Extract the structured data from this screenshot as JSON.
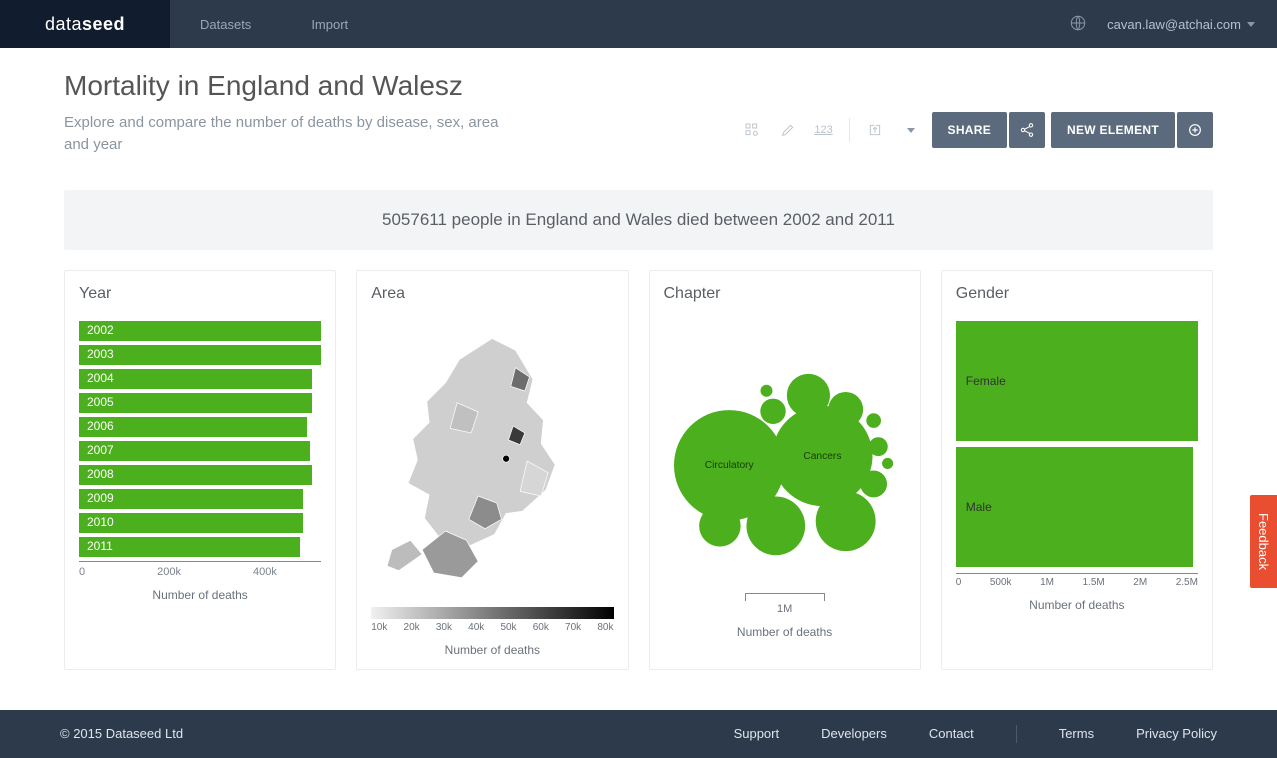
{
  "header": {
    "brand_left": "data",
    "brand_right": "seed",
    "nav": [
      "Datasets",
      "Import"
    ],
    "user_email": "cavan.law@atchai.com"
  },
  "page": {
    "title": "Mortality in England and Walesz",
    "subtitle": "Explore and compare the number of deaths by disease, sex, area and year"
  },
  "toolbar": {
    "num_label": "123",
    "share_label": "SHARE",
    "newelem_label": "NEW ELEMENT"
  },
  "summary": "5057611 people in England and Wales died between 2002 and 2011",
  "panels": {
    "year": {
      "title": "Year",
      "axis": "Number of deaths",
      "ticks": [
        "0",
        "200k",
        "400k"
      ]
    },
    "area": {
      "title": "Area",
      "axis": "Number of deaths",
      "ticks": [
        "10k",
        "20k",
        "30k",
        "40k",
        "50k",
        "60k",
        "70k",
        "80k"
      ]
    },
    "chapter": {
      "title": "Chapter",
      "axis": "Number of deaths",
      "scale": "1M"
    },
    "gender": {
      "title": "Gender",
      "axis": "Number of deaths",
      "ticks": [
        "0",
        "500k",
        "1M",
        "1.5M",
        "2M",
        "2.5M"
      ]
    }
  },
  "footer": {
    "copyright": "© 2015 Dataseed Ltd",
    "links": [
      "Support",
      "Developers",
      "Contact",
      "Terms",
      "Privacy Policy"
    ]
  },
  "feedback_label": "Feedback",
  "chart_data": [
    {
      "type": "bar",
      "orientation": "horizontal",
      "title": "Year",
      "xlabel": "Number of deaths",
      "xlim": [
        0,
        520000
      ],
      "categories": [
        "2002",
        "2003",
        "2004",
        "2005",
        "2006",
        "2007",
        "2008",
        "2009",
        "2010",
        "2011"
      ],
      "values": [
        520000,
        520000,
        500000,
        500000,
        490000,
        495000,
        500000,
        480000,
        480000,
        475000
      ]
    },
    {
      "type": "choropleth",
      "title": "Area",
      "metric": "Number of deaths",
      "legend_range": [
        10000,
        80000
      ],
      "note": "Values per England & Wales administrative area; ~175 areas shaded on greyscale low→high."
    },
    {
      "type": "bubble",
      "title": "Chapter",
      "metric": "Number of deaths",
      "scale_ref": 1000000,
      "items": [
        {
          "label": "Circulatory",
          "value": 1700000,
          "labeled": true
        },
        {
          "label": "Cancers",
          "value": 1400000,
          "labeled": true
        },
        {
          "label": "",
          "value": 500000
        },
        {
          "label": "",
          "value": 480000
        },
        {
          "label": "",
          "value": 260000
        },
        {
          "label": "",
          "value": 240000
        },
        {
          "label": "",
          "value": 170000
        },
        {
          "label": "",
          "value": 100000
        },
        {
          "label": "",
          "value": 90000
        },
        {
          "label": "",
          "value": 50000
        },
        {
          "label": "",
          "value": 30000
        },
        {
          "label": "",
          "value": 20000
        },
        {
          "label": "",
          "value": 17000
        }
      ]
    },
    {
      "type": "bar",
      "orientation": "horizontal",
      "title": "Gender",
      "xlabel": "Number of deaths",
      "xlim": [
        0,
        2500000
      ],
      "categories": [
        "Female",
        "Male"
      ],
      "values": [
        2600000,
        2450000
      ]
    }
  ]
}
